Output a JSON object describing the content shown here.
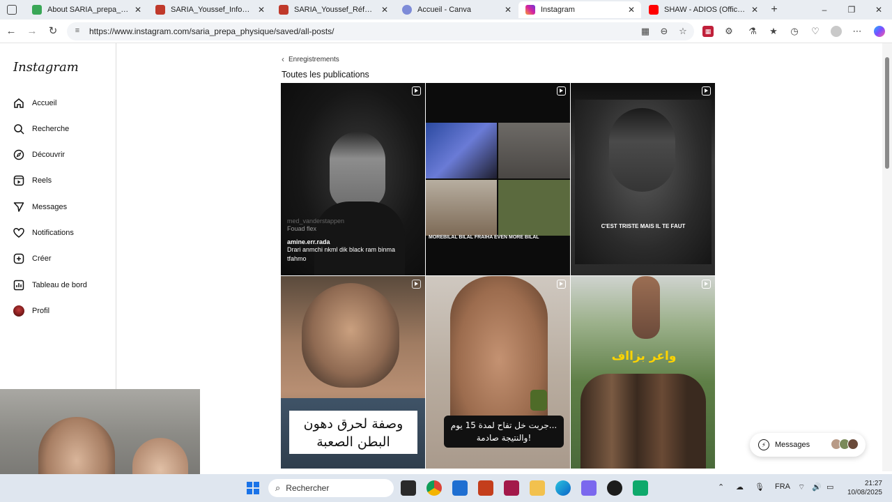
{
  "browser": {
    "tabs": [
      {
        "title": "About SARIA_prepa_physiqu",
        "favicon_color": "#3aa757",
        "active": false
      },
      {
        "title": "SARIA_Youssef_Infographie_",
        "favicon_color": "#c0392b",
        "active": false
      },
      {
        "title": "SARIA_Youssef_Références_F",
        "favicon_color": "#c0392b",
        "active": false
      },
      {
        "title": "Accueil - Canva",
        "favicon_color": "#7d8bd8",
        "active": false
      },
      {
        "title": "Instagram",
        "favicon_color": "#d6249f",
        "active": true
      },
      {
        "title": "SHAW - ADIOS (Official Mu",
        "favicon_color": "#ff0000",
        "active": false
      }
    ],
    "new_tab": "+",
    "url": "https://www.instagram.com/saria_prepa_physique/saved/all-posts/"
  },
  "instagram": {
    "logo": "Instagram",
    "nav": [
      {
        "label": "Accueil",
        "icon": "home-icon"
      },
      {
        "label": "Recherche",
        "icon": "search-icon"
      },
      {
        "label": "Découvrir",
        "icon": "compass-icon"
      },
      {
        "label": "Reels",
        "icon": "reels-icon"
      },
      {
        "label": "Messages",
        "icon": "messenger-icon"
      },
      {
        "label": "Notifications",
        "icon": "heart-icon"
      },
      {
        "label": "Créer",
        "icon": "plus-square-icon"
      },
      {
        "label": "Tableau de bord",
        "icon": "chart-icon"
      },
      {
        "label": "Profil",
        "icon": "avatar"
      }
    ],
    "breadcrumb": "Enregistrements",
    "section_title": "Toutes les publications",
    "posts": [
      {
        "caption_user": "amine.err.rada",
        "caption_text": "Drari anmchi nkml dik black ram binma",
        "caption_line3": "tfahmo",
        "watermark1": "med_vanderstappen",
        "watermark2": "Fouad flex"
      },
      {
        "overlay": "MOREBILAL  BILAL FRAIHA  EVEN MORE BILAL"
      },
      {
        "overlay": "C'EST TRISTE MAIS IL TE FAUT"
      },
      {
        "overlay_line1": "وصفة لحرق دهون",
        "overlay_line2": "البطن الصعبة"
      },
      {
        "overlay_line1": "جربت خل تفاح لمدة 15 يوم...",
        "overlay_line2": "والنتيجة صادمة!"
      },
      {
        "overlay": "واعر بزااف"
      }
    ],
    "messages_button": "Messages"
  },
  "taskbar": {
    "search_placeholder": "Rechercher",
    "language": "FRA",
    "time": "21:27",
    "date": "10/08/2025"
  }
}
